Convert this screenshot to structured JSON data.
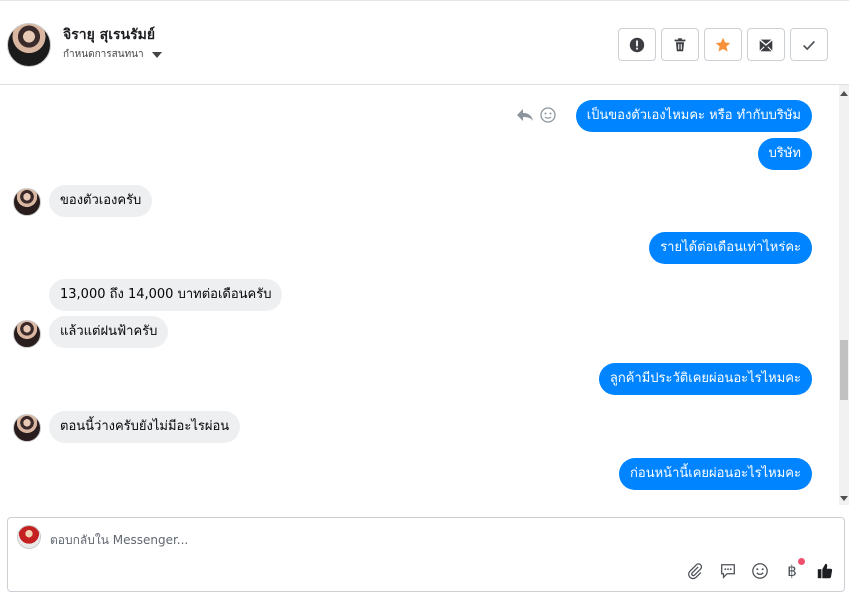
{
  "header": {
    "contact_name": "จิรายุ สุเรนรัมย์",
    "subtitle": "กำหนดการสนทนา",
    "buttons": [
      {
        "name": "spam-button",
        "icon": "alert-icon"
      },
      {
        "name": "delete-button",
        "icon": "trash-icon"
      },
      {
        "name": "star-button",
        "icon": "star-icon",
        "color": "#f7923b"
      },
      {
        "name": "mark-unread-button",
        "icon": "envelope-icon"
      },
      {
        "name": "done-button",
        "icon": "check-icon"
      }
    ]
  },
  "messages": [
    {
      "id": "m1",
      "from": "page",
      "text": "เป็นของตัวเองไหมคะ หรือ ทำกับบริษัม"
    },
    {
      "id": "m2",
      "from": "page",
      "text": "บริษัท"
    },
    {
      "id": "m3",
      "from": "customer",
      "text": "ของตัวเองครับ"
    },
    {
      "id": "m4",
      "from": "page",
      "text": "รายได้ต่อเดือนเท่าไหร่คะ"
    },
    {
      "id": "m5",
      "from": "customer",
      "text": "13,000 ถึง 14,000 บาทต่อเดือนครับ"
    },
    {
      "id": "m6",
      "from": "customer",
      "text": "แล้วแต่ฝนฟ้าครับ"
    },
    {
      "id": "m7",
      "from": "page",
      "text": "ลูกค้ามีประวัติเคยผ่อนอะไรไหมคะ"
    },
    {
      "id": "m8",
      "from": "customer",
      "text": "ตอนนี้ว่างครับยังไม่มีอะไรผ่อน"
    },
    {
      "id": "m9",
      "from": "page",
      "text": "ก่อนหน้านี้เคยผ่อนอะไรไหมคะ"
    }
  ],
  "composer": {
    "placeholder": "ตอบกลับใน Messenger...",
    "baht_symbol": "฿",
    "tools": [
      "paperclip-icon",
      "saved-reply-icon",
      "emoji-icon",
      "baht-icon",
      "like-icon"
    ]
  },
  "colors": {
    "outgoing_bubble": "#0084ff",
    "incoming_bubble": "#eeeff1",
    "star": "#f7923b",
    "notification_dot": "#f0506e"
  }
}
